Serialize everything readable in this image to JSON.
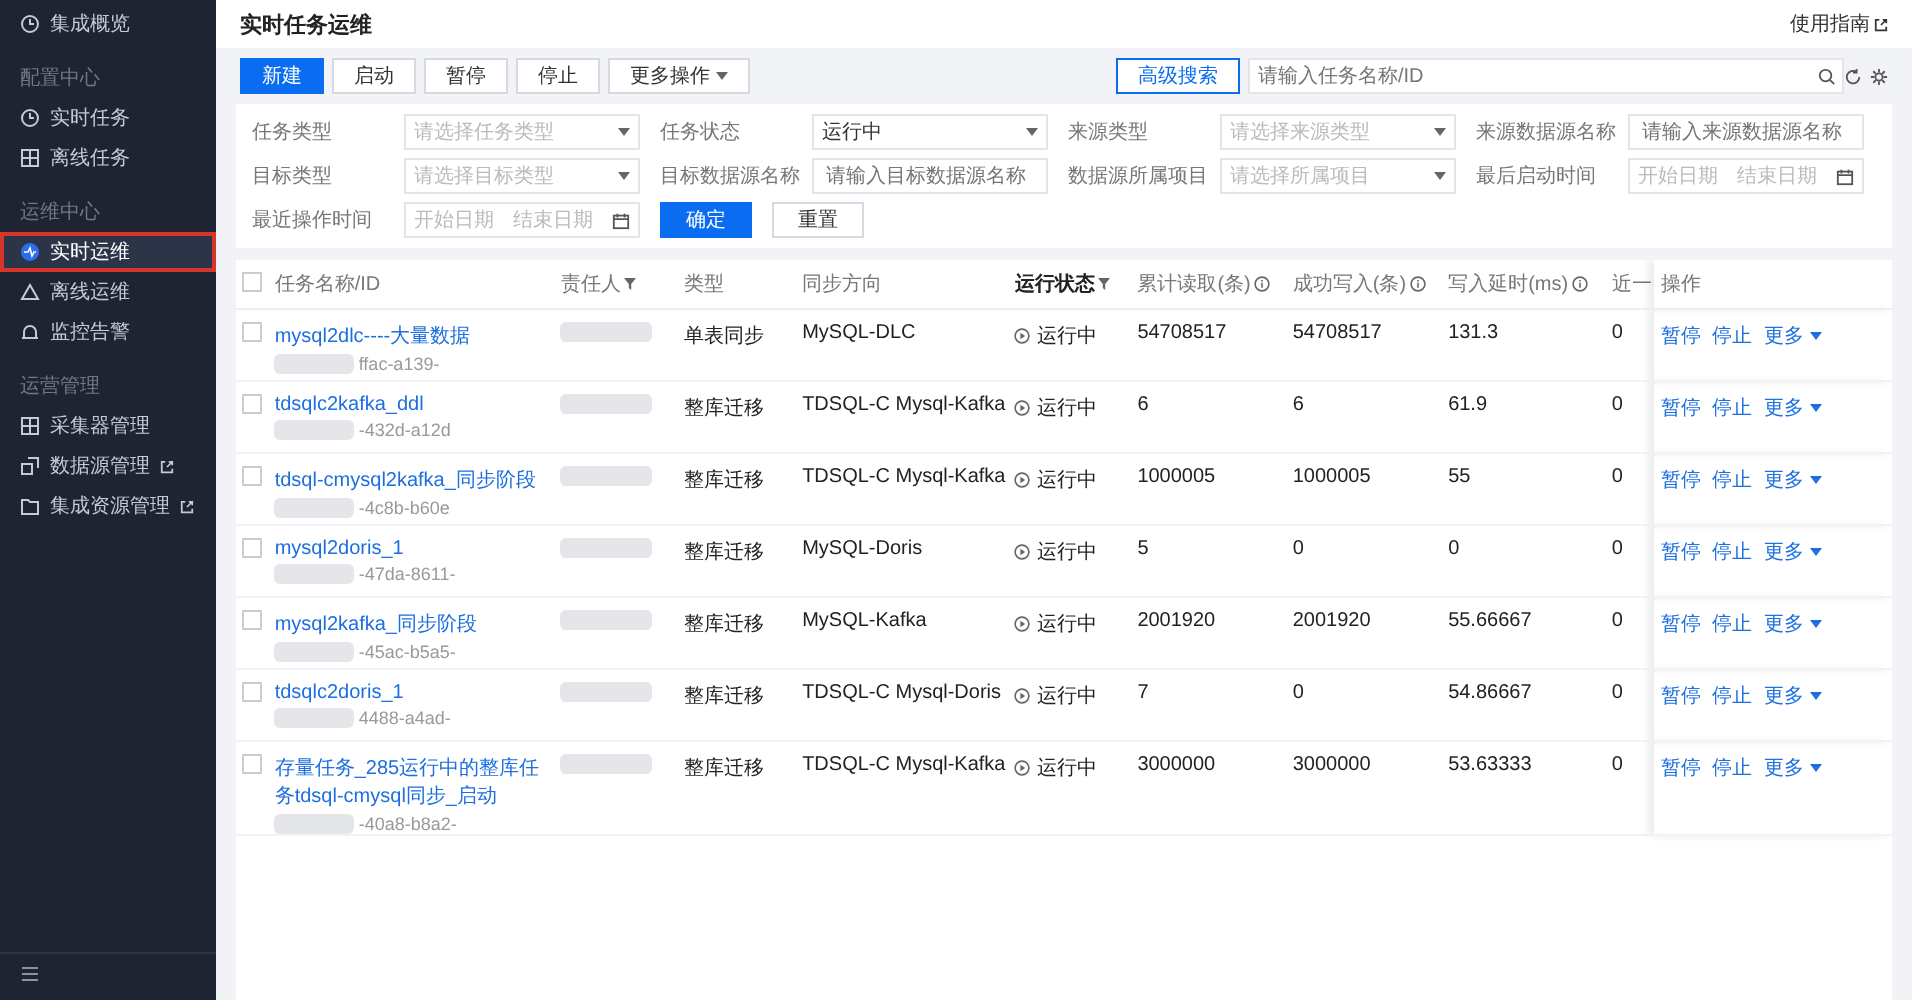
{
  "sidebar": {
    "sections": [
      {
        "items": [
          {
            "label": "集成概览",
            "external": false,
            "selected": false
          }
        ]
      },
      {
        "title": "配置中心",
        "items": [
          {
            "label": "实时任务",
            "external": false,
            "selected": false
          },
          {
            "label": "离线任务",
            "external": false,
            "selected": false
          }
        ]
      },
      {
        "title": "运维中心",
        "items": [
          {
            "label": "实时运维",
            "external": false,
            "selected": true
          },
          {
            "label": "离线运维",
            "external": false,
            "selected": false
          },
          {
            "label": "监控告警",
            "external": false,
            "selected": false
          }
        ]
      },
      {
        "title": "运营管理",
        "items": [
          {
            "label": "采集器管理",
            "external": false,
            "selected": false
          },
          {
            "label": "数据源管理",
            "external": true,
            "selected": false
          },
          {
            "label": "集成资源管理",
            "external": true,
            "selected": false
          }
        ]
      }
    ]
  },
  "header": {
    "title": "实时任务运维",
    "guide": "使用指南"
  },
  "toolbar": {
    "buttons": [
      {
        "label": "新建",
        "kind": "primary"
      },
      {
        "label": "启动",
        "kind": "default"
      },
      {
        "label": "暂停",
        "kind": "default"
      },
      {
        "label": "停止",
        "kind": "default"
      },
      {
        "label": "更多操作",
        "kind": "dropdown"
      }
    ],
    "advanced": "高级搜索",
    "search": {
      "placeholder": "请输入任务名称/ID"
    }
  },
  "filters": [
    [
      {
        "label": "任务类型",
        "kind": "select",
        "placeholder": "请选择任务类型"
      },
      {
        "label": "任务状态",
        "kind": "select",
        "value": "运行中"
      },
      {
        "label": "来源类型",
        "kind": "select",
        "placeholder": "请选择来源类型"
      },
      {
        "label": "来源数据源名称",
        "kind": "input",
        "placeholder": "请输入来源数据源名称"
      }
    ],
    [
      {
        "label": "目标类型",
        "kind": "select",
        "placeholder": "请选择目标类型"
      },
      {
        "label": "目标数据源名称",
        "kind": "input",
        "placeholder": "请输入目标数据源名称"
      },
      {
        "label": "数据源所属项目",
        "kind": "select",
        "placeholder": "请选择所属项目"
      },
      {
        "label": "最后启动时间",
        "kind": "range",
        "start": "开始日期",
        "end": "结束日期"
      }
    ],
    [
      {
        "label": "最近操作时间",
        "kind": "range",
        "start": "开始日期",
        "end": "结束日期"
      },
      {
        "label": "确定",
        "kind": "primary"
      },
      {
        "label": "重置",
        "kind": "button"
      }
    ]
  ],
  "table": {
    "select_all": {
      "checked": false
    },
    "columns": [
      {
        "label": "任务名称/ID",
        "kind": "plain"
      },
      {
        "label": "责任人",
        "kind": "filter"
      },
      {
        "label": "类型",
        "kind": "plain"
      },
      {
        "label": "同步方向",
        "kind": "plain"
      },
      {
        "label": "运行状态",
        "kind": "filter"
      },
      {
        "label": "累计读取(条)",
        "kind": "info"
      },
      {
        "label": "成功写入(条)",
        "kind": "info"
      },
      {
        "label": "写入延时(ms)",
        "kind": "info"
      },
      {
        "label": "近一",
        "kind": "plain"
      },
      {
        "label": "操作",
        "kind": "plain"
      }
    ],
    "rows": [
      {
        "checked": false,
        "name": "mysql2dlc----大量数据",
        "id": "ffac-a139-",
        "type": "单表同步",
        "direction": "MySQL-DLC",
        "status": "运行中",
        "read": "54708517",
        "written": "54708517",
        "delay": "131.3",
        "recent": "0",
        "actions": [
          "暂停",
          "停止",
          "更多"
        ]
      },
      {
        "checked": false,
        "name": "tdsqlc2kafka_ddl",
        "id": "-432d-a12d",
        "type": "整库迁移",
        "direction": "TDSQL-C Mysql-Kafka",
        "status": "运行中",
        "read": "6",
        "written": "6",
        "delay": "61.9",
        "recent": "0",
        "actions": [
          "暂停",
          "停止",
          "更多"
        ]
      },
      {
        "checked": false,
        "name": "tdsql-cmysql2kafka_同步阶段",
        "id": "-4c8b-b60e",
        "type": "整库迁移",
        "direction": "TDSQL-C Mysql-Kafka",
        "status": "运行中",
        "read": "1000005",
        "written": "1000005",
        "delay": "55",
        "recent": "0",
        "actions": [
          "暂停",
          "停止",
          "更多"
        ]
      },
      {
        "checked": false,
        "name": "mysql2doris_1",
        "id": "-47da-8611-",
        "type": "整库迁移",
        "direction": "MySQL-Doris",
        "status": "运行中",
        "read": "5",
        "written": "0",
        "delay": "0",
        "recent": "0",
        "actions": [
          "暂停",
          "停止",
          "更多"
        ]
      },
      {
        "checked": false,
        "name": "mysql2kafka_同步阶段",
        "id": "-45ac-b5a5-",
        "type": "整库迁移",
        "direction": "MySQL-Kafka",
        "status": "运行中",
        "read": "2001920",
        "written": "2001920",
        "delay": "55.66667",
        "recent": "0",
        "actions": [
          "暂停",
          "停止",
          "更多"
        ]
      },
      {
        "checked": false,
        "name": "tdsqlc2doris_1",
        "id": "4488-a4ad-",
        "type": "整库迁移",
        "direction": "TDSQL-C Mysql-Doris",
        "status": "运行中",
        "read": "7",
        "written": "0",
        "delay": "54.86667",
        "recent": "0",
        "actions": [
          "暂停",
          "停止",
          "更多"
        ]
      },
      {
        "checked": false,
        "name": "存量任务_285运行中的整库任务tdsql-cmysql同步_启动",
        "id": "-40a8-b8a2-",
        "type": "整库迁移",
        "direction": "TDSQL-C Mysql-Kafka",
        "status": "运行中",
        "read": "3000000",
        "written": "3000000",
        "delay": "53.63333",
        "recent": "0",
        "actions": [
          "暂停",
          "停止",
          "更多"
        ]
      }
    ]
  }
}
